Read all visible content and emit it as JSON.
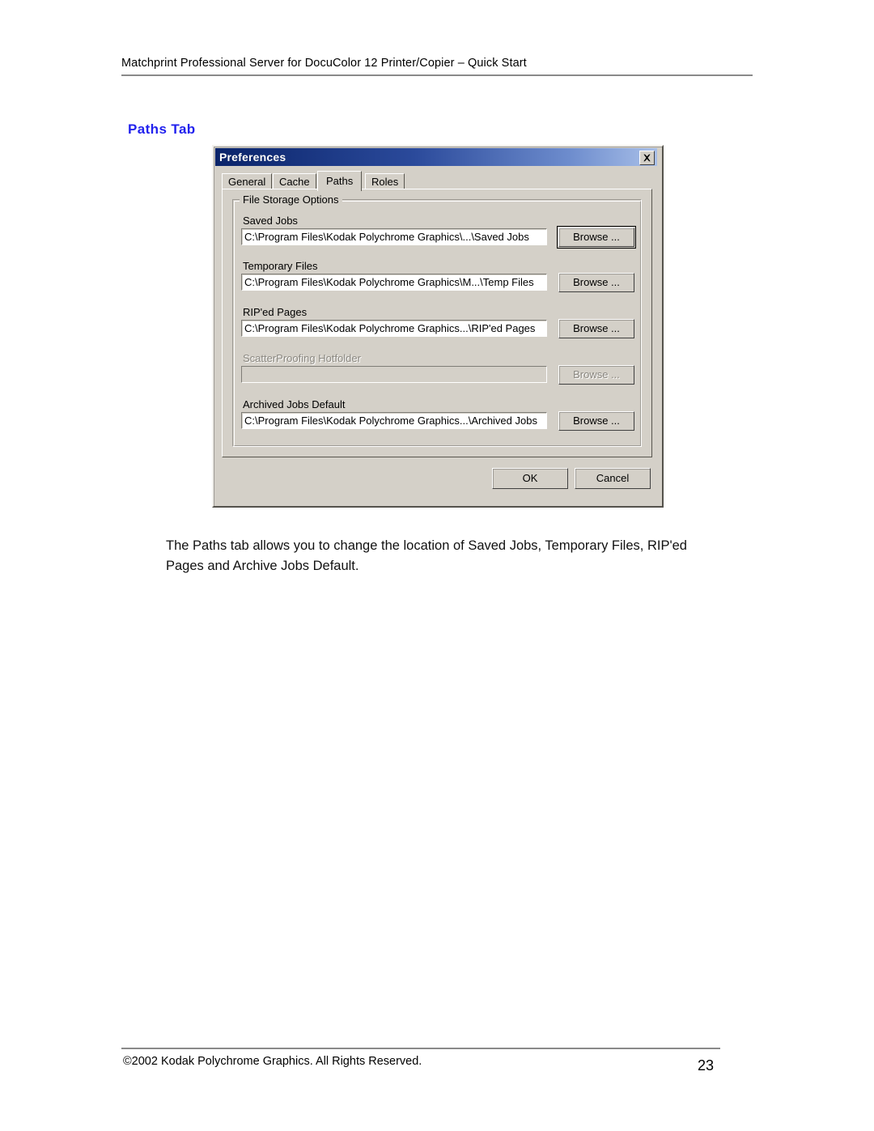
{
  "page": {
    "running_head": "Matchprint Professional Server for DocuColor 12 Printer/Copier – Quick Start",
    "section_title": "Paths Tab",
    "body_text": "The Paths tab allows you to change the location of Saved Jobs, Temporary Files, RIP'ed Pages and Archive Jobs Default.",
    "footer_copyright": "©2002 Kodak Polychrome Graphics. All Rights Reserved.",
    "page_number": "23",
    "heading_color": "#2222ee"
  },
  "dialog": {
    "title": "Preferences",
    "close_label": "×",
    "titlebar_gradient_start": "#0a246a",
    "titlebar_gradient_end": "#a8bfe8",
    "face_color": "#d4d0c8",
    "tabs": [
      {
        "label": "General",
        "selected": false
      },
      {
        "label": "Cache",
        "selected": false
      },
      {
        "label": "Paths",
        "selected": true
      },
      {
        "label": "Roles",
        "selected": false
      }
    ],
    "group": {
      "label": "File Storage Options",
      "fields": [
        {
          "label": "Saved Jobs",
          "value": "C:\\Program Files\\Kodak Polychrome Graphics\\...\\Saved Jobs",
          "placeholder": "",
          "disabled": false,
          "browse_label": "Browse ...",
          "browse_default": true
        },
        {
          "label": "Temporary Files",
          "value": "C:\\Program Files\\Kodak Polychrome Graphics\\M...\\Temp Files",
          "placeholder": "",
          "disabled": false,
          "browse_label": "Browse ...",
          "browse_default": false
        },
        {
          "label": "RIP'ed Pages",
          "value": "C:\\Program Files\\Kodak Polychrome Graphics...\\RIP'ed Pages",
          "placeholder": "",
          "disabled": false,
          "browse_label": "Browse ...",
          "browse_default": false
        },
        {
          "label": "ScatterProofing Hotfolder",
          "value": "",
          "placeholder": "",
          "disabled": true,
          "browse_label": "Browse ...",
          "browse_default": false
        },
        {
          "label": "Archived Jobs Default",
          "value": "C:\\Program Files\\Kodak Polychrome Graphics...\\Archived Jobs",
          "placeholder": "",
          "disabled": false,
          "browse_label": "Browse ...",
          "browse_default": false
        }
      ]
    },
    "ok_label": "OK",
    "cancel_label": "Cancel"
  }
}
